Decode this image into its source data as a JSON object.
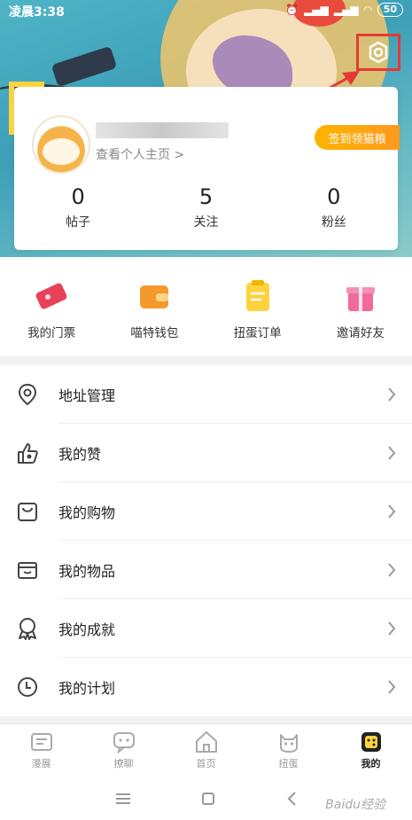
{
  "status_bar": {
    "time": "凌晨3:38",
    "battery": "50"
  },
  "profile": {
    "view_profile": "查看个人主页 >",
    "checkin_button": "签到领猫粮",
    "stats": [
      {
        "value": "0",
        "label": "帖子"
      },
      {
        "value": "5",
        "label": "关注"
      },
      {
        "value": "0",
        "label": "粉丝"
      }
    ]
  },
  "quick_actions": [
    {
      "label": "我的门票",
      "icon": "ticket-icon"
    },
    {
      "label": "喵特钱包",
      "icon": "wallet-icon"
    },
    {
      "label": "扭蛋订单",
      "icon": "order-icon"
    },
    {
      "label": "邀请好友",
      "icon": "gift-icon"
    }
  ],
  "menu": [
    {
      "label": "地址管理",
      "icon": "location-icon"
    },
    {
      "label": "我的赞",
      "icon": "thumbs-up-icon"
    },
    {
      "label": "我的购物",
      "icon": "shopping-bag-icon"
    },
    {
      "label": "我的物品",
      "icon": "box-icon"
    },
    {
      "label": "我的成就",
      "icon": "medal-icon"
    },
    {
      "label": "我的计划",
      "icon": "clock-icon"
    }
  ],
  "tabs": [
    {
      "label": "漫展",
      "icon": "expo-icon"
    },
    {
      "label": "撩聊",
      "icon": "chat-icon"
    },
    {
      "label": "首页",
      "icon": "home-icon"
    },
    {
      "label": "扭蛋",
      "icon": "cat-icon"
    },
    {
      "label": "我的",
      "icon": "profile-icon",
      "active": true
    }
  ],
  "watermark": "Baidu经验",
  "colors": {
    "accent": "#ffb300",
    "highlight": "#e53935",
    "active_tab": "#ffd23f"
  }
}
